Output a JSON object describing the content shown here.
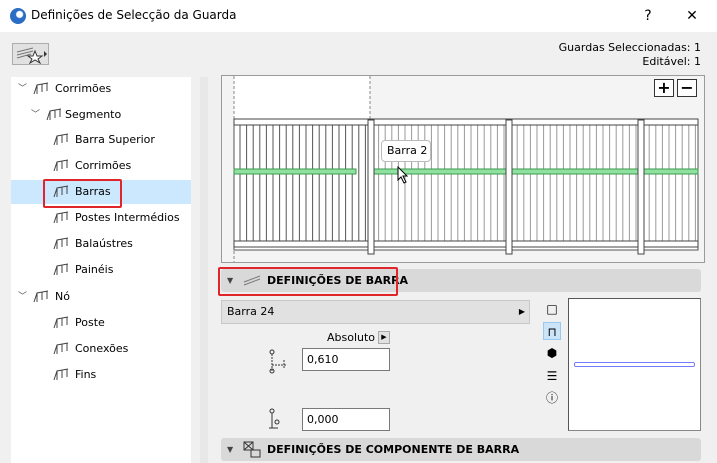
{
  "window": {
    "title": "Definições de Selecção da Guarda",
    "help": "?",
    "close": "✕"
  },
  "selection": {
    "selected": "Guardas Seleccionadas: 1",
    "editable": "Editável: 1"
  },
  "tree": [
    {
      "label": "Corrimões",
      "level": 0,
      "chev": "⌄"
    },
    {
      "label": "Segmento",
      "level": 1,
      "chev": "⌄"
    },
    {
      "label": "Barra Superior",
      "level": 2
    },
    {
      "label": "Corrimões",
      "level": 2
    },
    {
      "label": "Barras",
      "level": 2,
      "selected": true
    },
    {
      "label": "Postes Intermédios",
      "level": 2
    },
    {
      "label": "Balaústres",
      "level": 2
    },
    {
      "label": "Painéis",
      "level": 2
    },
    {
      "label": "Nó",
      "level": 0,
      "chev": "⌄"
    },
    {
      "label": "Poste",
      "level": 2
    },
    {
      "label": "Conexões",
      "level": 2
    },
    {
      "label": "Fins",
      "level": 2
    }
  ],
  "preview": {
    "tooltip": "Barra 2",
    "zoom_in": "+",
    "zoom_out": "−"
  },
  "bar_settings": {
    "title": "DEFINIÇÕES DE BARRA",
    "profile": "Barra 24",
    "mode": "Absoluto",
    "height_value": "0,610",
    "offset_value": "0,000"
  },
  "component_settings": {
    "title": "DEFINIÇÕES DE COMPONENTE DE BARRA"
  },
  "colors": {
    "selection": "#cce8ff",
    "highlight_red": "#e0262b",
    "bar_green": "#90e0a0"
  }
}
